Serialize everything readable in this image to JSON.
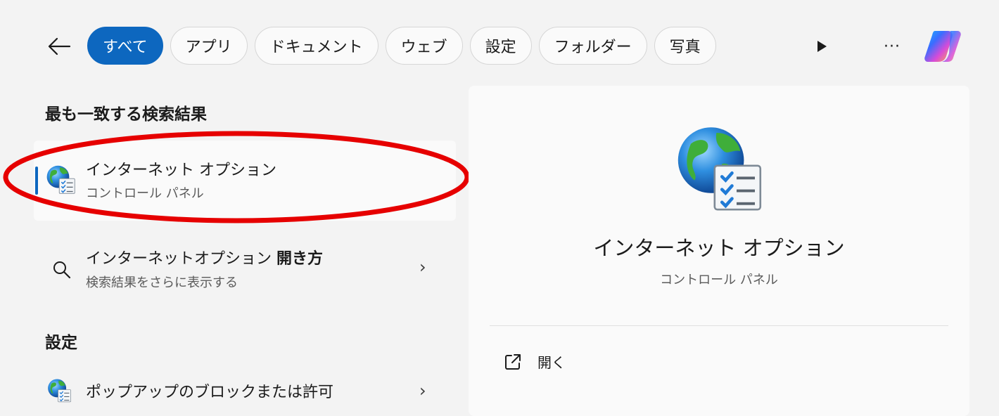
{
  "toolbar": {
    "back_icon": "arrow-left-icon",
    "filters": [
      {
        "label": "すべて",
        "active": true
      },
      {
        "label": "アプリ",
        "active": false
      },
      {
        "label": "ドキュメント",
        "active": false
      },
      {
        "label": "ウェブ",
        "active": false
      },
      {
        "label": "設定",
        "active": false
      },
      {
        "label": "フォルダー",
        "active": false
      },
      {
        "label": "写真",
        "active": false
      }
    ],
    "more_label": "···",
    "play_icon": "play-icon",
    "copilot_icon": "copilot-icon"
  },
  "best_match": {
    "section_title": "最も一致する検索結果",
    "title": "インターネット オプション",
    "subtitle": "コントロール パネル",
    "icon": "internet-options-icon"
  },
  "web_search": {
    "title": "インターネットオプション",
    "title_bold": "開き方",
    "subtitle": "検索結果をさらに表示する",
    "icon": "search-icon",
    "chevron": "›"
  },
  "settings": {
    "section_title": "設定",
    "items": [
      {
        "title": "ポップアップのブロックまたは許可",
        "icon": "internet-options-icon",
        "chevron": "›"
      }
    ]
  },
  "detail": {
    "title": "インターネット オプション",
    "subtitle": "コントロール パネル",
    "open_label": "開く",
    "open_icon": "open-external-icon"
  },
  "colors": {
    "accent": "#0d67bf",
    "highlight": "#e60000",
    "background": "#f3f3f3",
    "panel": "#fafafa"
  }
}
